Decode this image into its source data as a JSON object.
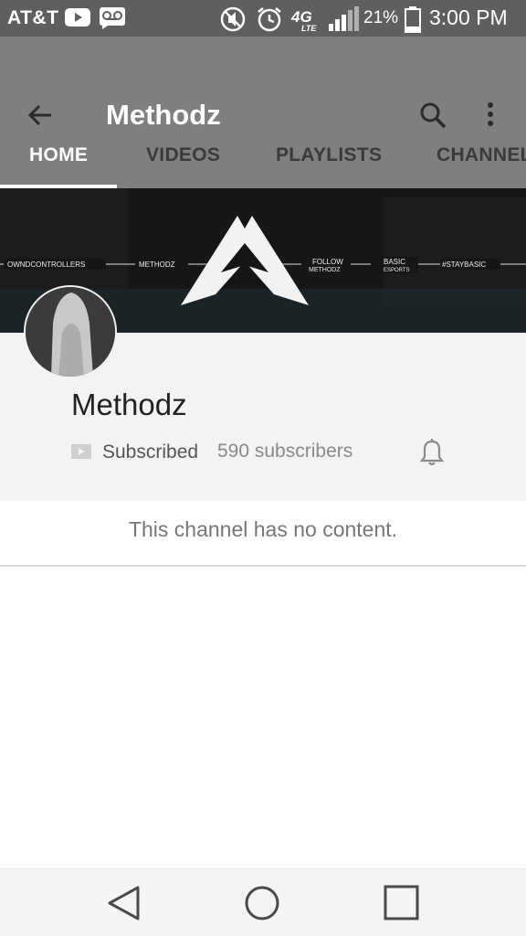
{
  "status_bar": {
    "carrier": "AT&T",
    "battery_percent": "21%",
    "time": "3:00 PM",
    "icons": [
      "youtube-icon",
      "voicemail-icon",
      "mute-icon",
      "alarm-icon",
      "4g-lte-icon",
      "signal-icon",
      "battery-icon"
    ]
  },
  "app_bar": {
    "title": "Methodz",
    "back_icon": "arrow-back-icon",
    "search_icon": "search-icon",
    "more_icon": "more-vert-icon"
  },
  "tabs": [
    {
      "label": "HOME",
      "active": true
    },
    {
      "label": "VIDEOS",
      "active": false
    },
    {
      "label": "PLAYLISTS",
      "active": false
    },
    {
      "label": "CHANNEL",
      "active": false
    }
  ],
  "banner": {
    "left_text": "OWNDCONTROLLERS",
    "center_left_text": "METHODZ",
    "follow_line1": "FOLLOW",
    "follow_line2": "METHODZ",
    "basic_line1": "BASIC",
    "basic_line2": "ESPORTS",
    "right_text": "#STAYBASIC"
  },
  "channel": {
    "name": "Methodz",
    "subscribed_label": "Subscribed",
    "subscriber_count": "590 subscribers"
  },
  "empty_message": "This channel has no content.",
  "nav_bar": {
    "back_icon": "nav-back-icon",
    "home_icon": "nav-home-icon",
    "recents_icon": "nav-recents-icon"
  },
  "colors": {
    "status_bar": "#5f5f5f",
    "app_bar": "#7f7f7f",
    "channel_section": "#f3f3f3",
    "nav_bar": "#f4f4f4"
  }
}
